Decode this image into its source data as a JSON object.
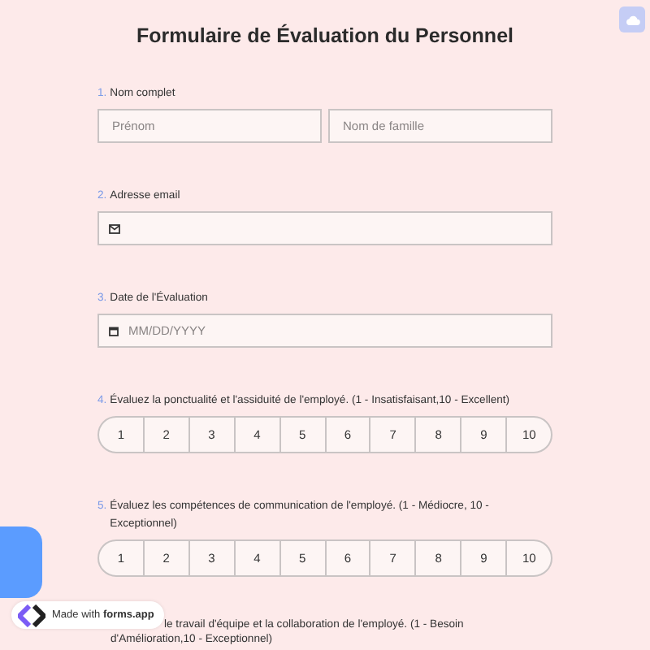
{
  "title": "Formulaire de Évaluation du Personnel",
  "questions": [
    {
      "number": "1.",
      "label": "Nom complet",
      "kind": "name",
      "placeholders": [
        "Prénom",
        "Nom de famille"
      ]
    },
    {
      "number": "2.",
      "label": "Adresse email",
      "kind": "email"
    },
    {
      "number": "3.",
      "label": "Date de l'Évaluation",
      "kind": "date",
      "placeholder": "MM/DD/YYYY"
    },
    {
      "number": "4.",
      "label": "Évaluez la ponctualité et l'assiduité de l'employé. (1 - Insatisfaisant,10 - Excellent)",
      "kind": "scale",
      "options": [
        "1",
        "2",
        "3",
        "4",
        "5",
        "6",
        "7",
        "8",
        "9",
        "10"
      ]
    },
    {
      "number": "5.",
      "label": "Évaluez les compétences de communication de l'employé. (1 - Médiocre, 10 - Exceptionnel)",
      "kind": "scale",
      "options": [
        "1",
        "2",
        "3",
        "4",
        "5",
        "6",
        "7",
        "8",
        "9",
        "10"
      ]
    },
    {
      "kind": "partial",
      "lines": [
        "le travail d'équipe et la collaboration de l'employé. (1 - Besoin",
        "d'Amélioration,10 - Exceptionnel)"
      ]
    }
  ],
  "badge": "Made with **forms.app**"
}
